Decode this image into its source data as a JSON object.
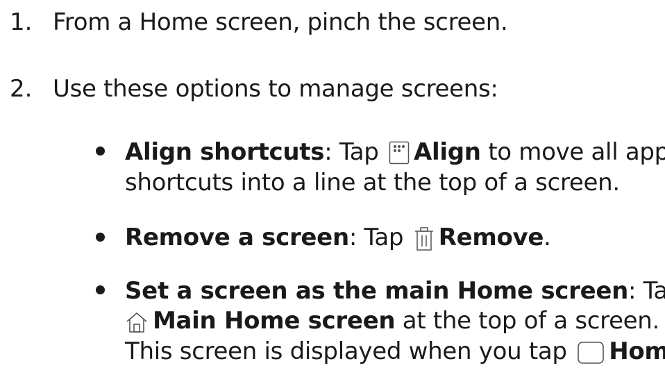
{
  "steps": [
    {
      "number": "1.",
      "text": "From a Home screen, pinch the screen."
    },
    {
      "number": "2.",
      "text": "Use these options to manage screens:"
    }
  ],
  "bullets": [
    {
      "title": "Align shortcuts",
      "sep": ": Tap",
      "icon": "align-grid-icon",
      "action": "Align",
      "rest": " to move all apps",
      "line2": "shortcuts into a line at the top of a screen."
    },
    {
      "title": "Remove a screen",
      "sep": ": Tap",
      "icon": "trash-icon",
      "action": "Remove",
      "rest": "."
    },
    {
      "title": "Set a screen as the main Home screen",
      "sep": ": Tap",
      "icon": "home-icon",
      "action": "Main Home screen",
      "rest": " at the top of a screen.",
      "line3": "This screen is displayed when you tap",
      "icon2": "home-button-icon",
      "action2": "Home",
      "rest2": "."
    }
  ]
}
